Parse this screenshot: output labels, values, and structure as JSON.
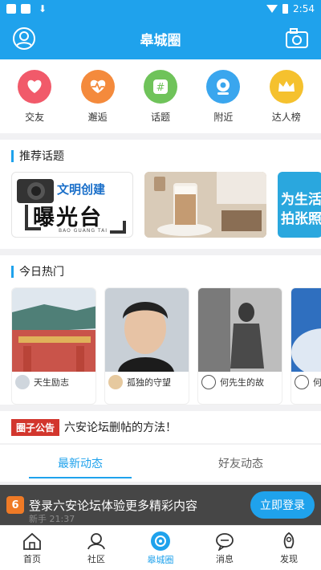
{
  "status_bar": {
    "time": "2:54"
  },
  "app_bar": {
    "title": "皋城圈"
  },
  "quick_actions": [
    {
      "label": "交友",
      "icon": "heart-icon",
      "color": "#f15a6a"
    },
    {
      "label": "邂逅",
      "icon": "heartbeat-icon",
      "color": "#f48a3c"
    },
    {
      "label": "话题",
      "icon": "hashtag-icon",
      "color": "#6fc35a"
    },
    {
      "label": "附近",
      "icon": "location-icon",
      "color": "#3aa6ee"
    },
    {
      "label": "达人榜",
      "icon": "crown-icon",
      "color": "#f5c12e"
    }
  ],
  "recommended": {
    "title": "推荐话题",
    "cards": [
      {
        "line1": "文明创建",
        "line2": "曝光台",
        "line3": "BAO GUANG TAI"
      },
      {
        "image": "coffee-photo"
      },
      {
        "line1": "为生活",
        "line2": "拍张照"
      }
    ]
  },
  "today_hot": {
    "title": "今日热门",
    "items": [
      {
        "name": "天生励志"
      },
      {
        "name": "孤独的守望"
      },
      {
        "name": "何先生的故"
      },
      {
        "name": "何"
      }
    ]
  },
  "notice": {
    "tag": "圈子公告",
    "text": "六安论坛删帖的方法！"
  },
  "tabs": [
    {
      "label": "最新动态",
      "active": true
    },
    {
      "label": "好友动态",
      "active": false
    }
  ],
  "login_banner": {
    "logo_text": "6",
    "message": "登录六安论坛体验更多精彩内容",
    "button": "立即登录",
    "ghost_text": "新手 21:37"
  },
  "bottom_nav": [
    {
      "label": "首页",
      "icon": "home-icon",
      "active": false
    },
    {
      "label": "社区",
      "icon": "community-icon",
      "active": false
    },
    {
      "label": "皋城圈",
      "icon": "circle-icon",
      "active": true
    },
    {
      "label": "消息",
      "icon": "message-icon",
      "active": false
    },
    {
      "label": "发现",
      "icon": "discover-icon",
      "active": false
    }
  ],
  "colors": {
    "primary": "#1fa2ec",
    "notice_tag": "#d2362d"
  }
}
